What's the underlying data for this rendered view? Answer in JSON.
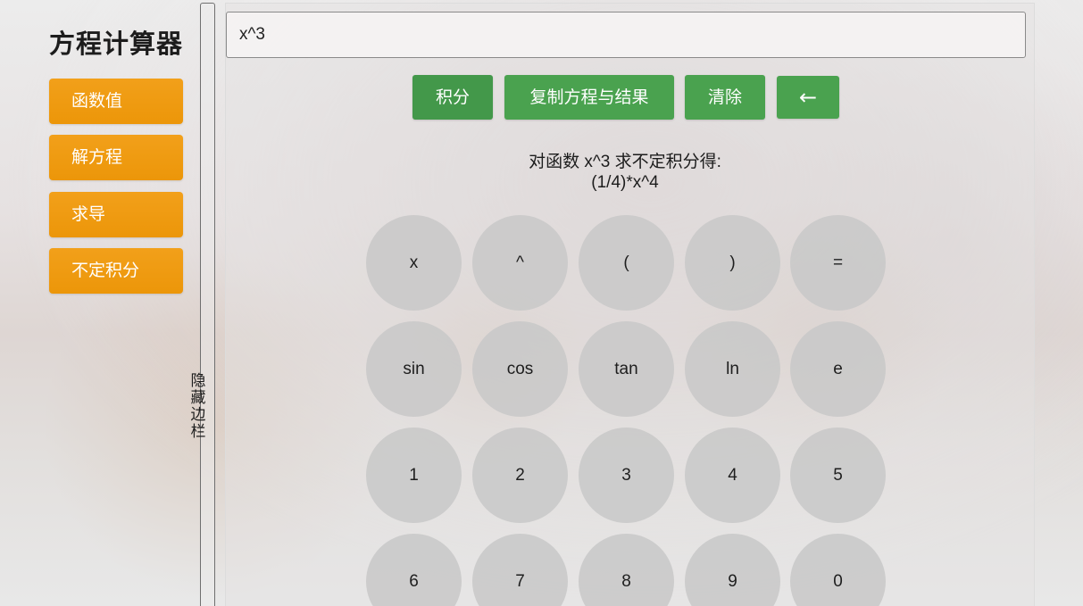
{
  "sidebar": {
    "title": "方程计算器",
    "nav": [
      {
        "label": "函数值"
      },
      {
        "label": "解方程"
      },
      {
        "label": "求导"
      },
      {
        "label": "不定积分"
      }
    ],
    "toggle_label": "隐藏边栏"
  },
  "main": {
    "input_value": "x^3",
    "actions": [
      {
        "label": "积分"
      },
      {
        "label": "复制方程与结果"
      },
      {
        "label": "清除"
      },
      {
        "label": "←"
      }
    ],
    "result": {
      "line1": "对函数 x^3 求不定积分得:",
      "line2": "(1/4)*x^4"
    },
    "keypad": [
      [
        "x",
        "^",
        "(",
        ")",
        "="
      ],
      [
        "sin",
        "cos",
        "tan",
        "ln",
        "e"
      ],
      [
        "1",
        "2",
        "3",
        "4",
        "5"
      ],
      [
        "6",
        "7",
        "8",
        "9",
        "0"
      ]
    ]
  },
  "colors": {
    "nav_button": "#f09c10",
    "action_button": "#4aa24f",
    "key": "#c8c8c8"
  }
}
